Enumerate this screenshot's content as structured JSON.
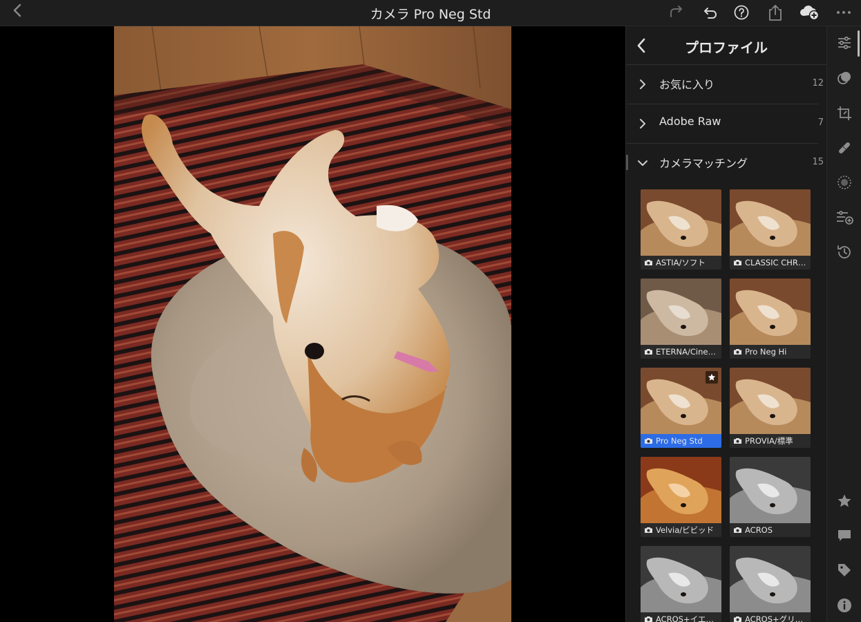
{
  "topbar": {
    "title": "カメラ Pro Neg Std",
    "icons": [
      "back-icon",
      "redo-icon",
      "undo-icon",
      "help-icon",
      "share-icon",
      "cloud-add-icon",
      "more-icon"
    ]
  },
  "panel": {
    "title": "プロファイル",
    "groups": [
      {
        "label": "お気に入り",
        "count": "12",
        "expanded": false
      },
      {
        "label": "Adobe Raw",
        "count": "7",
        "expanded": false
      },
      {
        "label": "カメラマッチング",
        "count": "15",
        "expanded": true
      }
    ],
    "profiles": [
      {
        "label": "ASTIA/ソフト",
        "style": "color",
        "selected": false,
        "favorite": false
      },
      {
        "label": "CLASSIC CHRO…",
        "style": "color",
        "selected": false,
        "favorite": false
      },
      {
        "label": "ETERNA/Cinema",
        "style": "muted",
        "selected": false,
        "favorite": false
      },
      {
        "label": "Pro Neg Hi",
        "style": "color",
        "selected": false,
        "favorite": false
      },
      {
        "label": "Pro Neg Std",
        "style": "color",
        "selected": true,
        "favorite": true
      },
      {
        "label": "PROVIA/標準",
        "style": "color",
        "selected": false,
        "favorite": false
      },
      {
        "label": "Velvia/ビビッド",
        "style": "vivid",
        "selected": false,
        "favorite": false
      },
      {
        "label": "ACROS",
        "style": "mono",
        "selected": false,
        "favorite": false
      },
      {
        "label": "ACROS+イエ…",
        "style": "mono",
        "selected": false,
        "favorite": false
      },
      {
        "label": "ACROS+グリ…",
        "style": "mono",
        "selected": false,
        "favorite": false
      }
    ]
  },
  "tools": {
    "icons": [
      "edit-sliders-icon",
      "masking-icon",
      "crop-icon",
      "healing-icon",
      "selective-icon",
      "presets-icon",
      "history-icon",
      "rating-star-icon",
      "comment-icon",
      "tag-icon",
      "info-icon"
    ]
  },
  "colors": {
    "accent": "#2d6ce6",
    "panel_bg": "#1b1b1b",
    "topbar_bg": "#1e1e1e"
  }
}
